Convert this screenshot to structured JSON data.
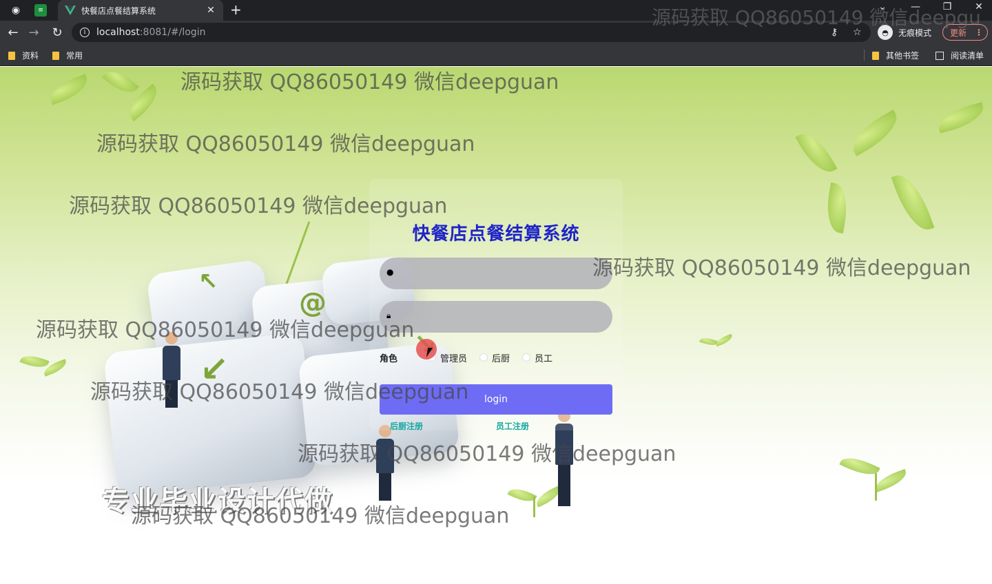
{
  "browser": {
    "tab_title": "快餐店点餐结算系统",
    "url_host": "localhost",
    "url_rest": ":8081/#/login",
    "incognito_label": "无痕模式",
    "update_label": "更新",
    "bookmarks": [
      "资料",
      "常用"
    ],
    "bookmarks_right": [
      "其他书签",
      "阅读清单"
    ]
  },
  "login": {
    "title": "快餐店点餐结算系统",
    "username_placeholder": "",
    "password_placeholder": "",
    "role_label": "角色",
    "roles": [
      "管理员",
      "后厨",
      "员工"
    ],
    "login_button": "login",
    "register_links": [
      "后厨注册",
      "员工注册"
    ]
  },
  "overlay": {
    "watermark": "源码获取 QQ86050149 微信deepguan",
    "top_watermark": "源码获取 QQ86050149 微信deepgu",
    "slogan": "专业毕业设计代做"
  },
  "colors": {
    "title": "#1f24c8",
    "login_button": "#6e6cf5",
    "register_link": "#17a8a0"
  }
}
